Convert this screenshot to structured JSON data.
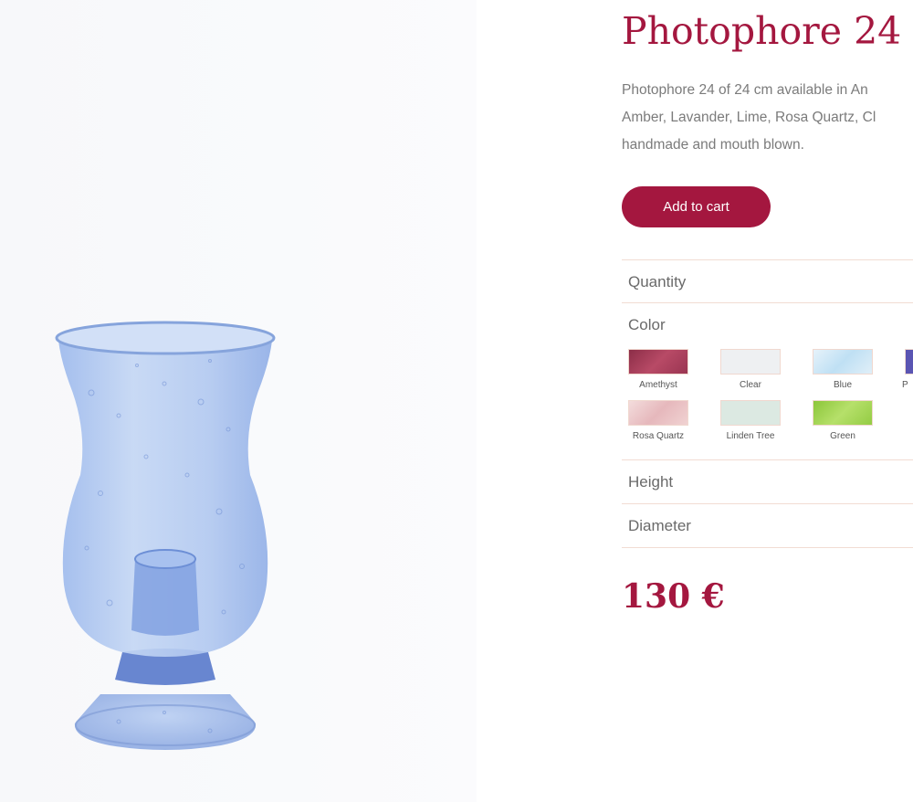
{
  "product": {
    "title": "Photophore 24",
    "description_lines": [
      "Photophore 24 of 24 cm available in An",
      "Amber, Lavander, Lime, Rosa Quartz, Cl",
      "handmade and mouth blown."
    ],
    "add_to_cart_label": "Add to cart",
    "price": "130 €"
  },
  "attributes": {
    "quantity_label": "Quantity",
    "color_label": "Color",
    "height_label": "Height",
    "diameter_label": "Diameter"
  },
  "colors": [
    {
      "name": "Amethyst",
      "swatch": "#a23a55"
    },
    {
      "name": "Clear",
      "swatch": "#eef0f2"
    },
    {
      "name": "Blue",
      "swatch": "#d8ecf6"
    },
    {
      "name": "P",
      "swatch": "#5a55b3"
    },
    {
      "name": "Rosa Quartz",
      "swatch": "#ecc8c8"
    },
    {
      "name": "Linden Tree",
      "swatch": "#dce9e2"
    },
    {
      "name": "Green",
      "swatch": "#9ecf4a"
    }
  ],
  "theme": {
    "accent": "#a4173f",
    "divider": "#f2dcd3",
    "glass": "#8eb0e8"
  }
}
